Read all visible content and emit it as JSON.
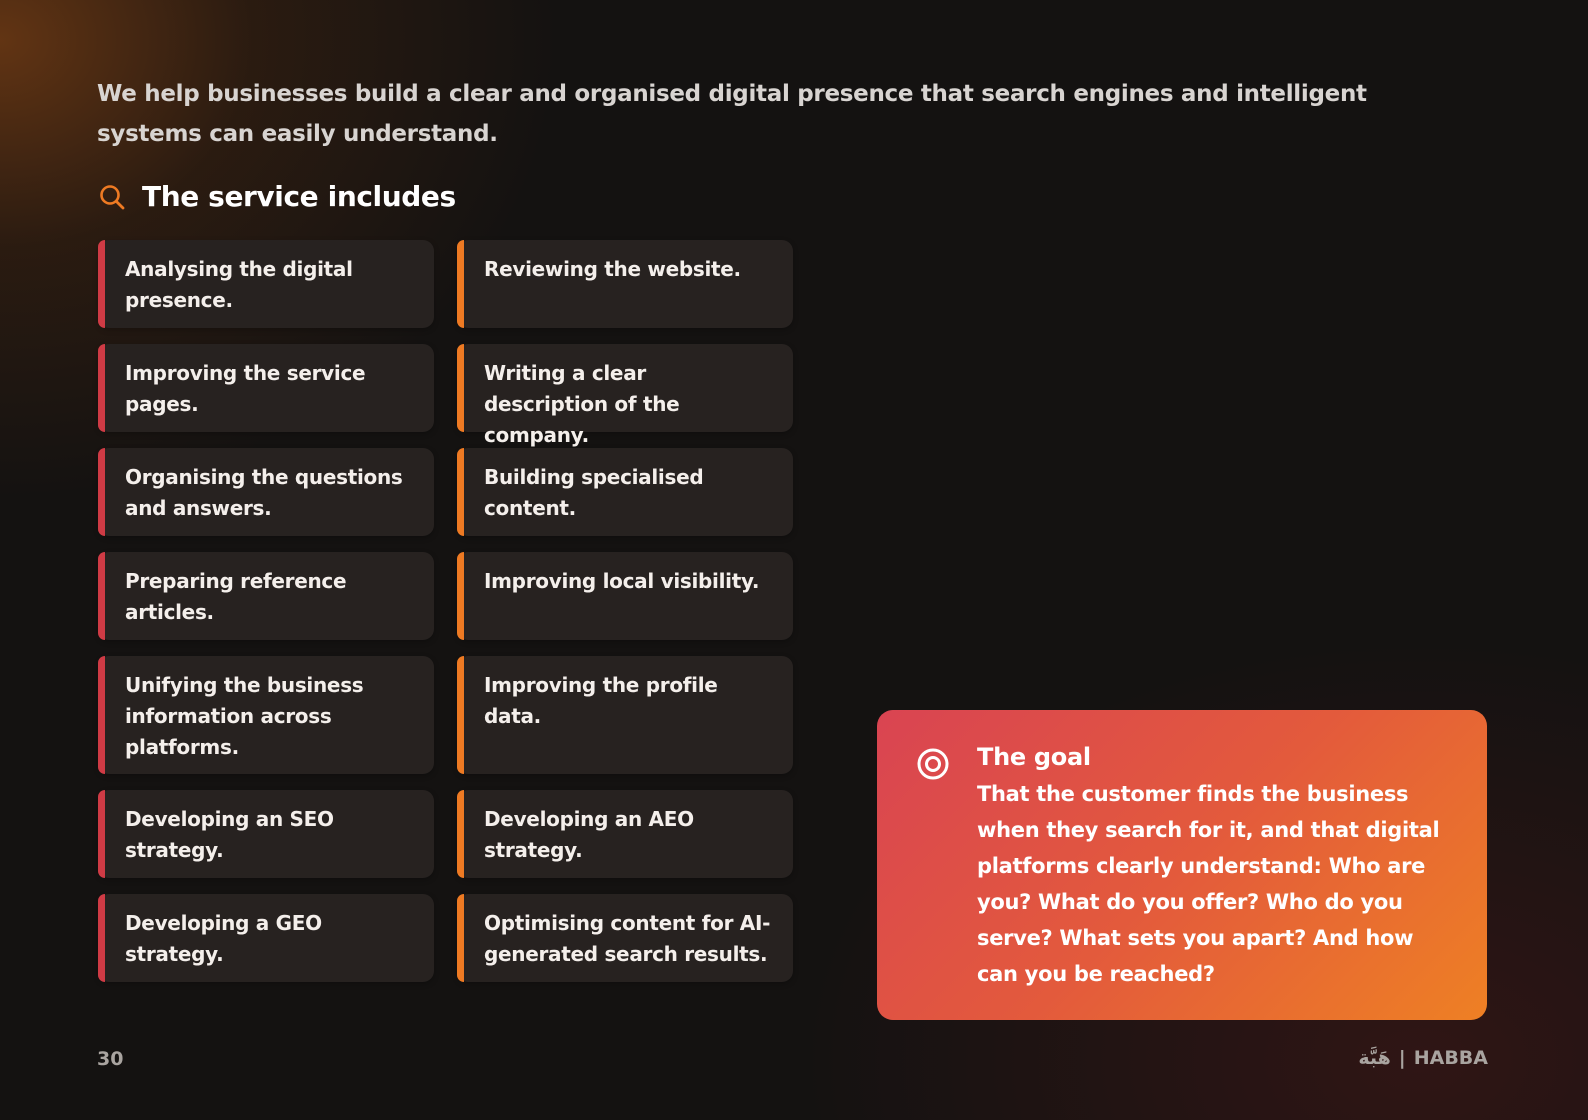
{
  "intro": "We help businesses build a clear and organised digital presence that search engines and intelligent systems can easily understand.",
  "section": {
    "title": "The service includes",
    "icon": "search-icon",
    "icon_color": "#ee7a23"
  },
  "services": [
    "Analysing the digital presence.",
    "Reviewing the website.",
    "Improving the service pages.",
    "Writing a clear description of the company.",
    "Organising the questions and answers.",
    "Building specialised content.",
    "Preparing reference articles.",
    "Improving local visibility.",
    "Unifying the business information across platforms.",
    "Improving the profile data.",
    "Developing an SEO strategy.",
    "Developing an AEO strategy.",
    "Developing a GEO strategy.",
    "Optimising content for AI-generated search results."
  ],
  "accent_colors": {
    "left_column": "#cf3b45",
    "right_column": "#ee7a23"
  },
  "goal": {
    "icon": "target-icon",
    "title": "The goal",
    "text": "That the customer finds the business when they search for it, and that digital platforms clearly understand: Who are you? What do you offer? Who do you serve? What sets you apart? And how can you be reached?"
  },
  "footer": {
    "page_number": "30",
    "brand_arabic": "هَبَّة",
    "brand_separator": "|",
    "brand_name": "HABBA"
  }
}
